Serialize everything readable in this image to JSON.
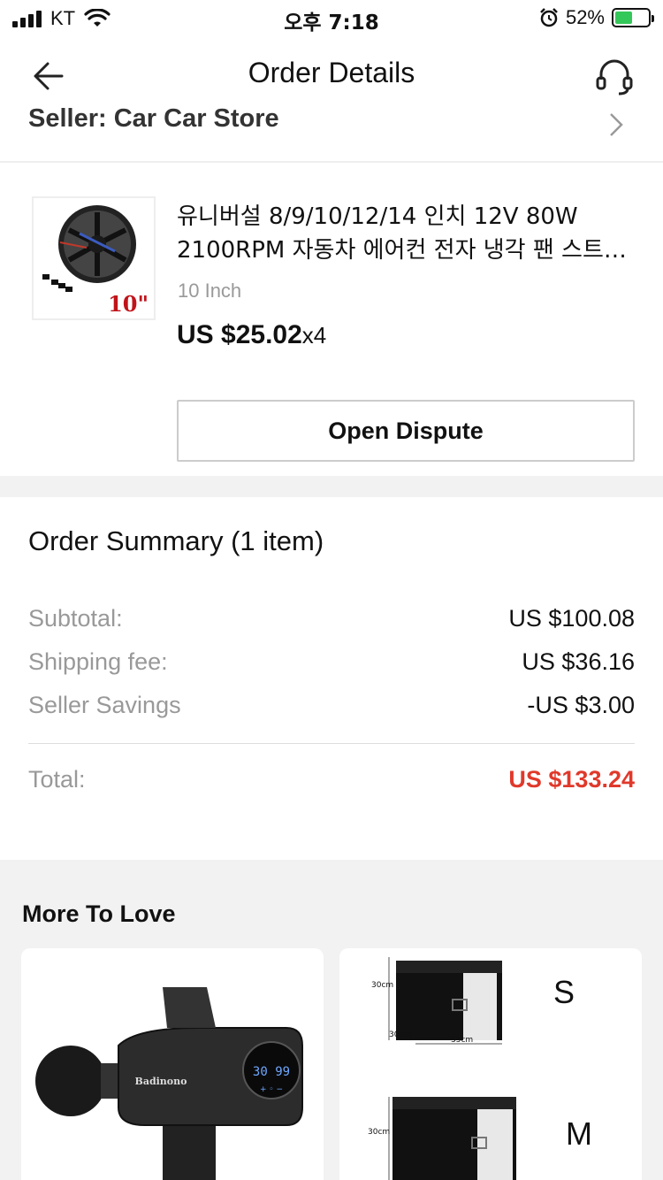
{
  "status_bar": {
    "carrier": "KT",
    "time": "오후 7:18",
    "battery_percent": "52%",
    "battery_level": 0.52
  },
  "nav": {
    "title": "Order Details",
    "back_icon": "arrow-left-icon",
    "support_icon": "headset-icon"
  },
  "seller": {
    "label": "Seller: Car Car Store"
  },
  "product": {
    "title": "유니버설 8/9/10/12/14 인치 12V 80W 2100RPM 자동차 에어컨 전자 냉각 팬 스트…",
    "thumb_size_label": "10\"",
    "variant": "10 Inch",
    "price": "US $25.02",
    "quantity": "x4",
    "dispute_button": "Open Dispute"
  },
  "summary": {
    "title": "Order Summary (1 item)",
    "rows": [
      {
        "label": "Subtotal:",
        "value": "US $100.08"
      },
      {
        "label": "Shipping fee:",
        "value": "US $36.16"
      },
      {
        "label": "Seller Savings",
        "value": "-US $3.00"
      }
    ],
    "total_label": "Total:",
    "total_value": "US $133.24",
    "accent_color": "#e0392b"
  },
  "more_to_love": {
    "title": "More To Love",
    "cards": [
      {
        "brand": "Badinono",
        "display": "30 99"
      },
      {
        "size_s": "S",
        "size_m": "M",
        "dim_h": "30cm",
        "dim_d": "30cm",
        "dim_w": "35cm"
      }
    ]
  }
}
